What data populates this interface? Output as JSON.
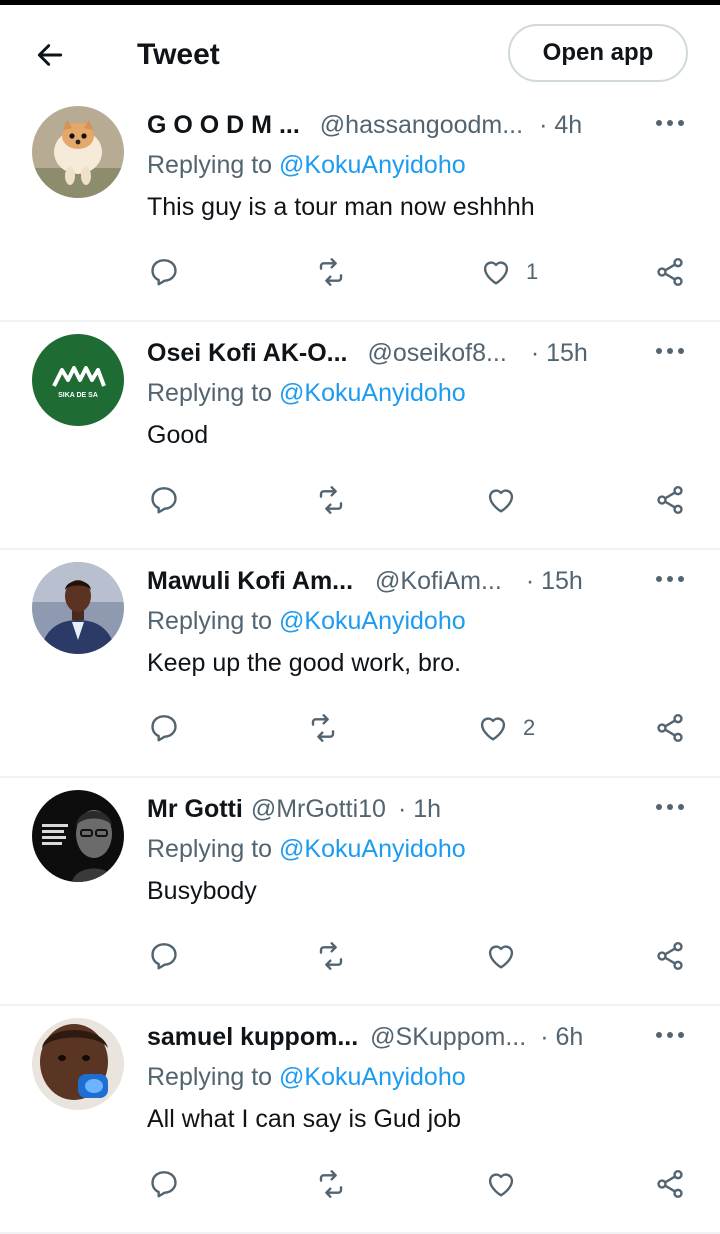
{
  "header": {
    "title": "Tweet",
    "open_app_label": "Open app"
  },
  "replying_prefix": "Replying to",
  "replies": [
    {
      "name": "G O O D M ...",
      "handle": "@hassangoodm...",
      "time": "· 4h",
      "reply_to": "@KokuAnyidoho",
      "text": "This guy is a tour man now eshhhh",
      "likes": "1",
      "avatar_icon": "pomeranian-dog-photo"
    },
    {
      "name": "Osei Kofi AK-O...",
      "handle": "@oseikof8...",
      "time": "· 15h",
      "reply_to": "@KokuAnyidoho",
      "text": "Good",
      "likes": "",
      "avatar_icon": "sika-de-sa-logo",
      "avatar_label": "SIKA DE SA"
    },
    {
      "name": "Mawuli Kofi Am...",
      "handle": "@KofiAm...",
      "time": "· 15h",
      "reply_to": "@KokuAnyidoho",
      "text": "Keep up the good work, bro.",
      "likes": "2",
      "avatar_icon": "man-in-suit-photo"
    },
    {
      "name": "Mr Gotti",
      "handle": "@MrGotti10",
      "time": "· 1h",
      "reply_to": "@KokuAnyidoho",
      "text": "Busybody",
      "likes": "",
      "avatar_icon": "black-white-portrait-photo"
    },
    {
      "name": "samuel kuppom...",
      "handle": "@SKuppom...",
      "time": "· 6h",
      "reply_to": "@KokuAnyidoho",
      "text": "All what I can say is Gud job",
      "likes": "",
      "avatar_icon": "baby-photo"
    }
  ],
  "colors": {
    "accent": "#1d9bf0",
    "text": "#0f1419",
    "secondary": "#536471",
    "divider": "#eff3f4",
    "avatar_green": "#1f6b34"
  }
}
